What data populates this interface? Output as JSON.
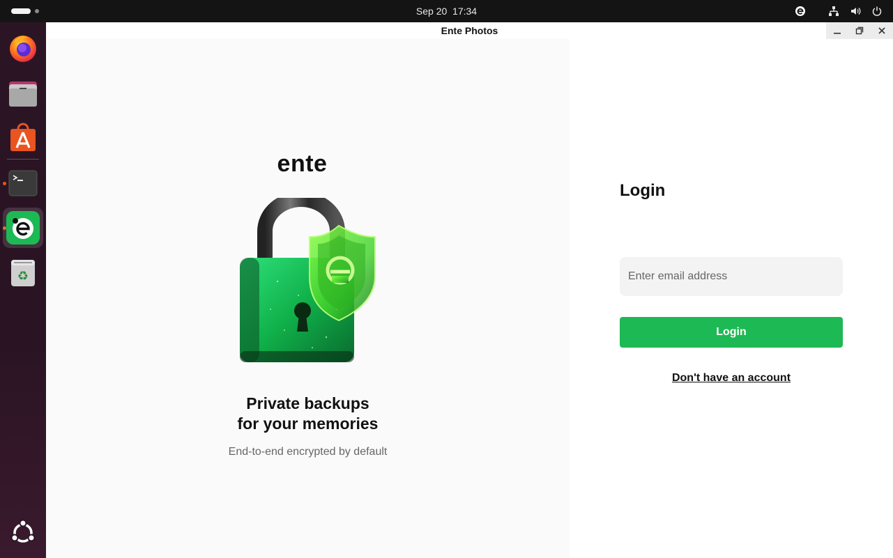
{
  "topbar": {
    "date": "Sep 20",
    "time": "17:34",
    "tray_icons": [
      "ente-tray-icon",
      "network-icon",
      "volume-icon",
      "power-icon"
    ]
  },
  "dock": {
    "items": [
      {
        "name": "firefox",
        "icon": "firefox-icon"
      },
      {
        "name": "files",
        "icon": "files-icon"
      },
      {
        "name": "app-center",
        "icon": "app-center-icon"
      },
      {
        "name": "terminal",
        "icon": "terminal-icon",
        "running": true
      },
      {
        "name": "ente",
        "icon": "ente-app-icon",
        "running": true,
        "active": true
      },
      {
        "name": "trash",
        "icon": "trash-icon"
      }
    ],
    "show_apps_icon": "ubuntu-show-apps-icon"
  },
  "window": {
    "title": "Ente Photos",
    "controls": [
      "minimize-icon",
      "maximize-icon",
      "close-icon"
    ]
  },
  "left": {
    "brand": "ente",
    "tagline_line1": "Private backups",
    "tagline_line2": "for your memories",
    "subtitle": "End-to-end encrypted by default"
  },
  "login": {
    "heading": "Login",
    "email_placeholder": "Enter email address",
    "email_value": "",
    "button_label": "Login",
    "signup_link": "Don't have an account"
  },
  "colors": {
    "accent_green": "#1db954",
    "topbar_bg": "#141414",
    "dock_bg": "#2b1524",
    "ubuntu_orange": "#e95420"
  }
}
